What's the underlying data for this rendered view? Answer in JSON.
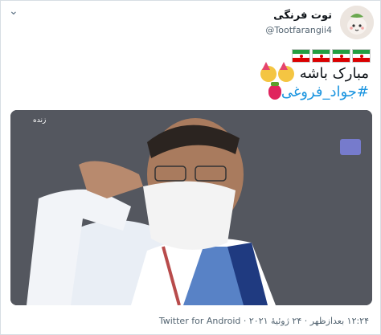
{
  "tweet": {
    "display_name": "توت فرنگی",
    "handle": "@Tootfarangii4",
    "text_line1": "مبارک باشه",
    "hashtag": "#جواد_فروغی",
    "footer": "۱۲:۲۴ بعدازظهر · ۲۴ ژوئیهٔ ۲۰۲۱ · Twitter for Android"
  },
  "media": {
    "channel_label": "زنده",
    "description": "Man in face mask saluting"
  },
  "icons": {
    "more": "chevron-down-icon",
    "avatar": "strawberry-avatar-icon"
  },
  "colors": {
    "hashtag_blue": "#1b95e0",
    "text_dark": "#0f1419",
    "meta_gray": "#536471",
    "iran_green": "#239f40",
    "iran_red": "#da0000"
  }
}
